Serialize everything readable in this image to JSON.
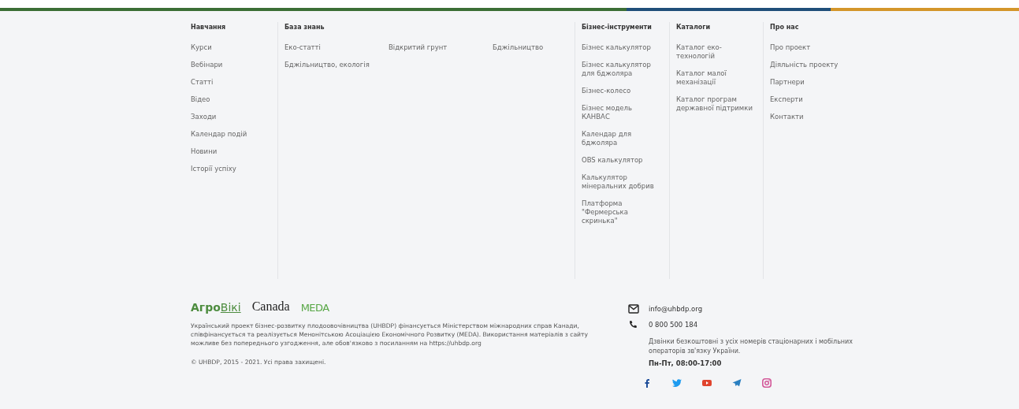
{
  "top_stripe": [
    {
      "color": "#3b6e35"
    },
    {
      "color": "#1f4e79"
    },
    {
      "color": "#d4962a"
    }
  ],
  "menu_columns": [
    {
      "title": "Навчання",
      "grid": false,
      "items": [
        "Курси",
        "Вебінари",
        "Статті",
        "Відео",
        "Заходи",
        "Календар подій",
        "Новини",
        "Історії успіху"
      ]
    },
    {
      "title": "База знань",
      "grid": true,
      "items": [
        "Еко-статті",
        "Відкритий грунт",
        "Бджільництво",
        "Бджільництво, екологія"
      ]
    },
    {
      "title": "Бізнес-інструменти",
      "grid": false,
      "items": [
        "Бізнес калькулятор",
        "Бізнес калькулятор для бджоляра",
        "Бізнес-колесо",
        "Бізнес модель КАНВАС",
        "Календар для бджоляра",
        "OBS калькулятор",
        "Калькулятор мінеральних добрив",
        "Платформа \"Фермерська скринька\""
      ]
    },
    {
      "title": "Каталоги",
      "grid": false,
      "items": [
        "Каталог еко-технологій",
        "Каталог малої механізації",
        "Каталог програм державної підтримки"
      ]
    },
    {
      "title": "Про нас",
      "grid": false,
      "items": [
        "Про проект",
        "Діяльність проекту",
        "Партнери",
        "Експерти",
        "Контакти"
      ]
    }
  ],
  "logos": {
    "agro": "Агро",
    "wiki": "Вікі",
    "canada": "Canada",
    "meda": "MEDA"
  },
  "description": "Український проект бізнес-розвитку плодоовочівництва (UHBDP) фінансується Міністерством міжнародних справ Канади, співфінансується та реалізується Менонітською Асоціацією Економічного Розвитку (MEDA). Використання матеріалів з сайту можливе без попереднього узгодження, але обов'язково з посиланням на https://uhbdp.org",
  "copyright": "© UHBDP, 2015 - 2021. Усі права захищені.",
  "contacts": {
    "email": "info@uhbdp.org",
    "phone": "0 800 500 184",
    "note": "Дзвінки безкоштовні з усіх номерів стаціонарних і мобільних операторів зв'язку України.",
    "hours": "Пн-Пт, 08:00-17:00"
  },
  "social": [
    {
      "kind": "facebook",
      "color": "#1f4e9a"
    },
    {
      "kind": "twitter",
      "color": "#1d9bf0"
    },
    {
      "kind": "youtube",
      "color": "#e0442e"
    },
    {
      "kind": "telegram",
      "color": "#2a7fc0"
    },
    {
      "kind": "instagram",
      "color": "#d35a9a"
    }
  ]
}
